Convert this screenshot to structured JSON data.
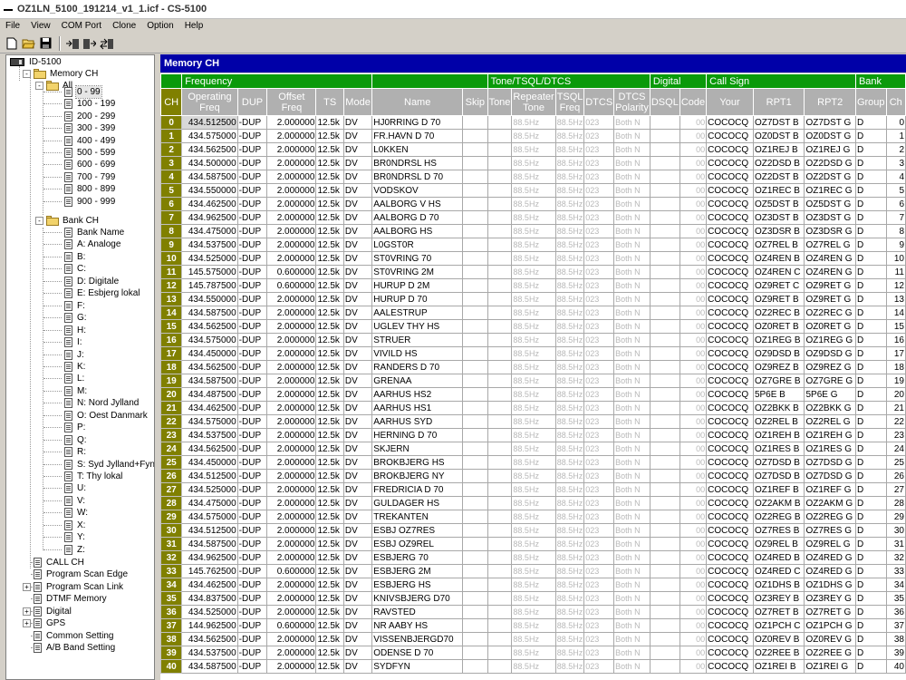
{
  "window": {
    "title": "OZ1LN_5100_191214_v1_1.icf - CS-5100"
  },
  "menu": [
    "File",
    "View",
    "COM Port",
    "Clone",
    "Option",
    "Help"
  ],
  "toolbar": {
    "icons": [
      "new-icon",
      "open-icon",
      "save-icon",
      "read-from-radio-icon",
      "write-to-radio-icon",
      "clone-icon"
    ]
  },
  "tree": {
    "root": "ID-5100",
    "memory_ch": "Memory CH",
    "all": "All",
    "ranges": [
      "0 - 99",
      "100 - 199",
      "200 - 299",
      "300 - 399",
      "400 - 499",
      "500 - 599",
      "600 - 699",
      "700 - 799",
      "800 - 899",
      "900 - 999"
    ],
    "bank_ch": "Bank CH",
    "banks": [
      "Bank Name",
      "A: Analoge",
      "B:",
      "C:",
      "D: Digitale",
      "E: Esbjerg lokal",
      "F:",
      "G:",
      "H:",
      "I:",
      "J:",
      "K:",
      "L:",
      "M:",
      "N: Nord Jylland",
      "O: Oest Danmark",
      "P:",
      "Q:",
      "R:",
      "S: Syd Jylland+Fyn",
      "T: Thy lokal",
      "U:",
      "V:",
      "W:",
      "X:",
      "Y:",
      "Z:"
    ],
    "bottom": [
      {
        "label": "CALL CH",
        "expander": false
      },
      {
        "label": "Program Scan Edge",
        "expander": false
      },
      {
        "label": "Program Scan Link",
        "expander": true
      },
      {
        "label": "DTMF Memory",
        "expander": false
      },
      {
        "label": "Digital",
        "expander": true
      },
      {
        "label": "GPS",
        "expander": true
      },
      {
        "label": "Common Setting",
        "expander": false
      },
      {
        "label": "A/B Band Setting",
        "expander": false
      }
    ]
  },
  "main": {
    "title": "Memory CH"
  },
  "groups": [
    {
      "label": "",
      "span": 1
    },
    {
      "label": "Frequency",
      "span": 5
    },
    {
      "label": "",
      "span": 2
    },
    {
      "label": "Tone/TSQL/DTCS",
      "span": 5
    },
    {
      "label": "Digital",
      "span": 2
    },
    {
      "label": "Call Sign",
      "span": 3
    },
    {
      "label": "Bank",
      "span": 2
    }
  ],
  "columns": [
    "CH",
    "Operating Freq",
    "DUP",
    "Offset Freq",
    "TS",
    "Mode",
    "Name",
    "Skip",
    "Tone",
    "Repeater Tone",
    "TSQL Freq",
    "DTCS",
    "DTCS Polarity",
    "DSQL",
    "Code",
    "Your",
    "RPT1",
    "RPT2",
    "Group",
    "Ch"
  ],
  "tone_defaults": {
    "tone": "",
    "rpt_tone": "88.5Hz",
    "tsql": "88.5Hz",
    "dtcs": "023",
    "polarity": "Both N",
    "dsql": "",
    "code": "00"
  },
  "rows": [
    [
      "0",
      "434.512500",
      "-DUP",
      "2.000000",
      "12.5k",
      "DV",
      "HJ0RRING D 70",
      "COCOCQ",
      "OZ7DST B",
      "OZ7DST G",
      "D",
      "0"
    ],
    [
      "1",
      "434.575000",
      "-DUP",
      "2.000000",
      "12.5k",
      "DV",
      "FR.HAVN D 70",
      "COCOCQ",
      "OZ0DST B",
      "OZ0DST G",
      "D",
      "1"
    ],
    [
      "2",
      "434.562500",
      "-DUP",
      "2.000000",
      "12.5k",
      "DV",
      "L0KKEN",
      "COCOCQ",
      "OZ1REJ B",
      "OZ1REJ G",
      "D",
      "2"
    ],
    [
      "3",
      "434.500000",
      "-DUP",
      "2.000000",
      "12.5k",
      "DV",
      "BR0NDRSL HS",
      "COCOCQ",
      "OZ2DSD B",
      "OZ2DSD G",
      "D",
      "3"
    ],
    [
      "4",
      "434.587500",
      "-DUP",
      "2.000000",
      "12.5k",
      "DV",
      "BR0NDRSL D 70",
      "COCOCQ",
      "OZ2DST B",
      "OZ2DST G",
      "D",
      "4"
    ],
    [
      "5",
      "434.550000",
      "-DUP",
      "2.000000",
      "12.5k",
      "DV",
      "VODSKOV",
      "COCOCQ",
      "OZ1REC B",
      "OZ1REC G",
      "D",
      "5"
    ],
    [
      "6",
      "434.462500",
      "-DUP",
      "2.000000",
      "12.5k",
      "DV",
      "AALBORG V HS",
      "COCOCQ",
      "OZ5DST B",
      "OZ5DST G",
      "D",
      "6"
    ],
    [
      "7",
      "434.962500",
      "-DUP",
      "2.000000",
      "12.5k",
      "DV",
      "AALBORG D 70",
      "COCOCQ",
      "OZ3DST B",
      "OZ3DST G",
      "D",
      "7"
    ],
    [
      "8",
      "434.475000",
      "-DUP",
      "2.000000",
      "12.5k",
      "DV",
      "AALBORG HS",
      "COCOCQ",
      "OZ3DSR B",
      "OZ3DSR G",
      "D",
      "8"
    ],
    [
      "9",
      "434.537500",
      "-DUP",
      "2.000000",
      "12.5k",
      "DV",
      "L0GST0R",
      "COCOCQ",
      "OZ7REL B",
      "OZ7REL G",
      "D",
      "9"
    ],
    [
      "10",
      "434.525000",
      "-DUP",
      "2.000000",
      "12.5k",
      "DV",
      "ST0VRING 70",
      "COCOCQ",
      "OZ4REN B",
      "OZ4REN G",
      "D",
      "10"
    ],
    [
      "11",
      "145.575000",
      "-DUP",
      "0.600000",
      "12.5k",
      "DV",
      "ST0VRING 2M",
      "COCOCQ",
      "OZ4REN C",
      "OZ4REN G",
      "D",
      "11"
    ],
    [
      "12",
      "145.787500",
      "-DUP",
      "0.600000",
      "12.5k",
      "DV",
      "HURUP D 2M",
      "COCOCQ",
      "OZ9RET C",
      "OZ9RET G",
      "D",
      "12"
    ],
    [
      "13",
      "434.550000",
      "-DUP",
      "2.000000",
      "12.5k",
      "DV",
      "HURUP D 70",
      "COCOCQ",
      "OZ9RET B",
      "OZ9RET G",
      "D",
      "13"
    ],
    [
      "14",
      "434.587500",
      "-DUP",
      "2.000000",
      "12.5k",
      "DV",
      "AALESTRUP",
      "COCOCQ",
      "OZ2REC B",
      "OZ2REC G",
      "D",
      "14"
    ],
    [
      "15",
      "434.562500",
      "-DUP",
      "2.000000",
      "12.5k",
      "DV",
      "UGLEV THY HS",
      "COCOCQ",
      "OZ0RET B",
      "OZ0RET G",
      "D",
      "15"
    ],
    [
      "16",
      "434.575000",
      "-DUP",
      "2.000000",
      "12.5k",
      "DV",
      "STRUER",
      "COCOCQ",
      "OZ1REG B",
      "OZ1REG G",
      "D",
      "16"
    ],
    [
      "17",
      "434.450000",
      "-DUP",
      "2.000000",
      "12.5k",
      "DV",
      "VIVILD HS",
      "COCOCQ",
      "OZ9DSD B",
      "OZ9DSD G",
      "D",
      "17"
    ],
    [
      "18",
      "434.562500",
      "-DUP",
      "2.000000",
      "12.5k",
      "DV",
      "RANDERS D 70",
      "COCOCQ",
      "OZ9REZ B",
      "OZ9REZ G",
      "D",
      "18"
    ],
    [
      "19",
      "434.587500",
      "-DUP",
      "2.000000",
      "12.5k",
      "DV",
      "GRENAA",
      "COCOCQ",
      "OZ7GRE B",
      "OZ7GRE G",
      "D",
      "19"
    ],
    [
      "20",
      "434.487500",
      "-DUP",
      "2.000000",
      "12.5k",
      "DV",
      "AARHUS HS2",
      "COCOCQ",
      "5P6E  B",
      "5P6E  G",
      "D",
      "20"
    ],
    [
      "21",
      "434.462500",
      "-DUP",
      "2.000000",
      "12.5k",
      "DV",
      "AARHUS HS1",
      "COCOCQ",
      "OZ2BKK B",
      "OZ2BKK G",
      "D",
      "21"
    ],
    [
      "22",
      "434.575000",
      "-DUP",
      "2.000000",
      "12.5k",
      "DV",
      "AARHUS SYD",
      "COCOCQ",
      "OZ2REL B",
      "OZ2REL G",
      "D",
      "22"
    ],
    [
      "23",
      "434.537500",
      "-DUP",
      "2.000000",
      "12.5k",
      "DV",
      "HERNING D 70",
      "COCOCQ",
      "OZ1REH B",
      "OZ1REH G",
      "D",
      "23"
    ],
    [
      "24",
      "434.562500",
      "-DUP",
      "2.000000",
      "12.5k",
      "DV",
      "SKJERN",
      "COCOCQ",
      "OZ1RES B",
      "OZ1RES G",
      "D",
      "24"
    ],
    [
      "25",
      "434.450000",
      "-DUP",
      "2.000000",
      "12.5k",
      "DV",
      "BROKBJERG HS",
      "COCOCQ",
      "OZ7DSD B",
      "OZ7DSD G",
      "D",
      "25"
    ],
    [
      "26",
      "434.512500",
      "-DUP",
      "2.000000",
      "12.5k",
      "DV",
      "BROKBJERG NY",
      "COCOCQ",
      "OZ7DSD B",
      "OZ7DSD G",
      "D",
      "26"
    ],
    [
      "27",
      "434.525000",
      "-DUP",
      "2.000000",
      "12.5k",
      "DV",
      "FREDRICIA D 70",
      "COCOCQ",
      "OZ1REF B",
      "OZ1REF G",
      "D",
      "27"
    ],
    [
      "28",
      "434.475000",
      "-DUP",
      "2.000000",
      "12.5k",
      "DV",
      "GULDAGER HS",
      "COCOCQ",
      "OZ2AKM B",
      "OZ2AKM G",
      "D",
      "28"
    ],
    [
      "29",
      "434.575000",
      "-DUP",
      "2.000000",
      "12.5k",
      "DV",
      "TREKANTEN",
      "COCOCQ",
      "OZ2REG B",
      "OZ2REG G",
      "D",
      "29"
    ],
    [
      "30",
      "434.512500",
      "-DUP",
      "2.000000",
      "12.5k",
      "DV",
      "ESBJ OZ7RES",
      "COCOCQ",
      "OZ7RES B",
      "OZ7RES G",
      "D",
      "30"
    ],
    [
      "31",
      "434.587500",
      "-DUP",
      "2.000000",
      "12.5k",
      "DV",
      "ESBJ OZ9REL",
      "COCOCQ",
      "OZ9REL B",
      "OZ9REL G",
      "D",
      "31"
    ],
    [
      "32",
      "434.962500",
      "-DUP",
      "2.000000",
      "12.5k",
      "DV",
      "ESBJERG 70",
      "COCOCQ",
      "OZ4RED B",
      "OZ4RED G",
      "D",
      "32"
    ],
    [
      "33",
      "145.762500",
      "-DUP",
      "0.600000",
      "12.5k",
      "DV",
      "ESBJERG 2M",
      "COCOCQ",
      "OZ4RED C",
      "OZ4RED G",
      "D",
      "33"
    ],
    [
      "34",
      "434.462500",
      "-DUP",
      "2.000000",
      "12.5k",
      "DV",
      "ESBJERG HS",
      "COCOCQ",
      "OZ1DHS B",
      "OZ1DHS G",
      "D",
      "34"
    ],
    [
      "35",
      "434.837500",
      "-DUP",
      "2.000000",
      "12.5k",
      "DV",
      "KNIVSBJERG D70",
      "COCOCQ",
      "OZ3REY B",
      "OZ3REY G",
      "D",
      "35"
    ],
    [
      "36",
      "434.525000",
      "-DUP",
      "2.000000",
      "12.5k",
      "DV",
      "RAVSTED",
      "COCOCQ",
      "OZ7RET B",
      "OZ7RET G",
      "D",
      "36"
    ],
    [
      "37",
      "144.962500",
      "-DUP",
      "0.600000",
      "12.5k",
      "DV",
      "NR AABY HS",
      "COCOCQ",
      "OZ1PCH C",
      "OZ1PCH G",
      "D",
      "37"
    ],
    [
      "38",
      "434.562500",
      "-DUP",
      "2.000000",
      "12.5k",
      "DV",
      "VISSENBJERGD70",
      "COCOCQ",
      "OZ0REV B",
      "OZ0REV G",
      "D",
      "38"
    ],
    [
      "39",
      "434.537500",
      "-DUP",
      "2.000000",
      "12.5k",
      "DV",
      "ODENSE D 70",
      "COCOCQ",
      "OZ2REE B",
      "OZ2REE G",
      "D",
      "39"
    ],
    [
      "40",
      "434.587500",
      "-DUP",
      "2.000000",
      "12.5k",
      "DV",
      "SYDFYN",
      "COCOCQ",
      "OZ1REI B",
      "OZ1REI G",
      "D",
      "40"
    ]
  ]
}
